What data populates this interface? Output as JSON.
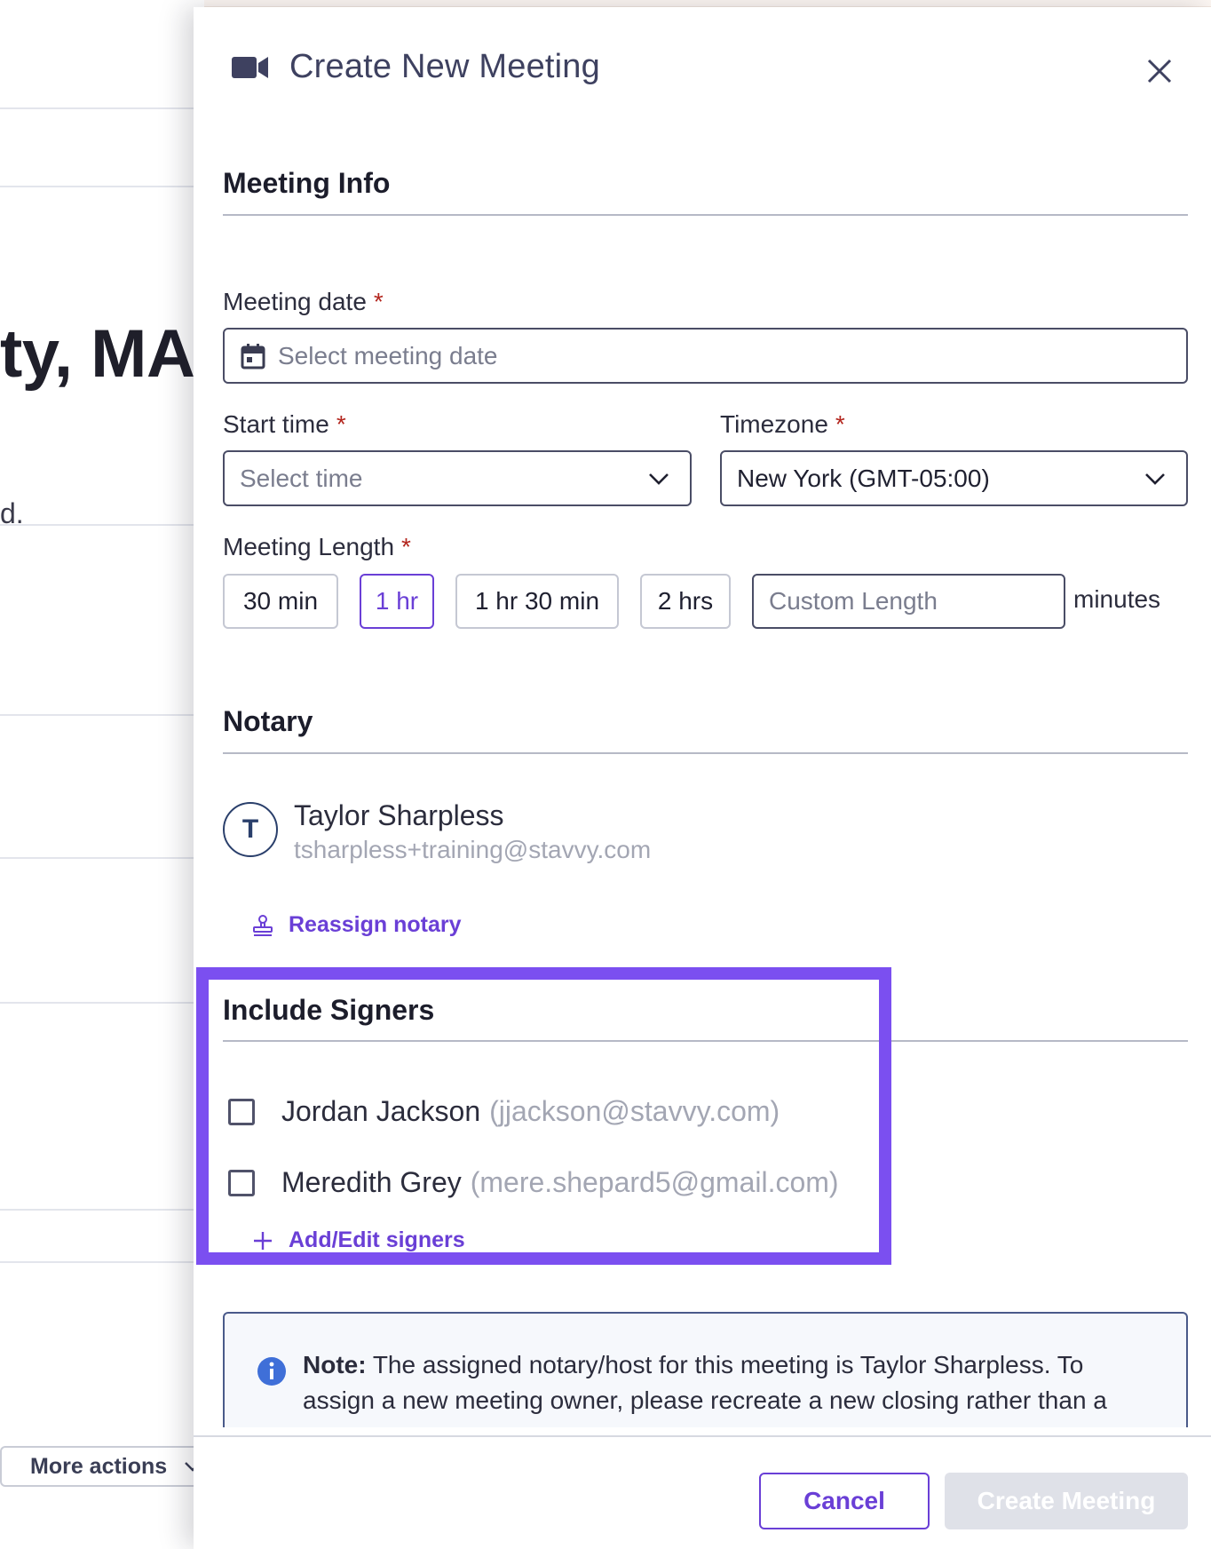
{
  "background": {
    "heading_fragment": "ty, MA",
    "text_fragment": "d.",
    "more_actions_label": "More actions"
  },
  "modal": {
    "title": "Create New Meeting",
    "title_icon": "video-camera-icon",
    "close_icon": "close-icon"
  },
  "meeting_info": {
    "section_title": "Meeting Info",
    "date_label": "Meeting date",
    "date_placeholder": "Select meeting date",
    "start_time_label": "Start time",
    "start_time_placeholder": "Select time",
    "timezone_label": "Timezone",
    "timezone_value": "New York (GMT-05:00)",
    "length_label": "Meeting Length",
    "required_mark": "*",
    "length_options": [
      "30 min",
      "1 hr",
      "1 hr 30 min",
      "2 hrs"
    ],
    "selected_length": "1 hr",
    "custom_length_placeholder": "Custom Length",
    "minutes_label": "minutes"
  },
  "notary": {
    "section_title": "Notary",
    "avatar_initial": "T",
    "name": "Taylor Sharpless",
    "email": "tsharpless+training@stavvy.com",
    "reassign_label": "Reassign notary"
  },
  "signers": {
    "section_title": "Include Signers",
    "items": [
      {
        "name": "Jordan Jackson",
        "email": "(jjackson@stavvy.com)",
        "checked": false
      },
      {
        "name": "Meredith Grey",
        "email": "(mere.shepard5@gmail.com)",
        "checked": false
      }
    ],
    "add_edit_label": "Add/Edit signers"
  },
  "note": {
    "prefix": "Note:",
    "text": "The assigned notary/host for this meeting is Taylor Sharpless. To assign a new meeting owner, please recreate a new closing rather than a"
  },
  "footer": {
    "cancel_label": "Cancel",
    "create_label": "Create Meeting"
  },
  "colors": {
    "accent": "#6a3fd6",
    "highlight": "#7b4ff0",
    "required": "#b3261e",
    "disabled_button": "#dfe1e8"
  }
}
